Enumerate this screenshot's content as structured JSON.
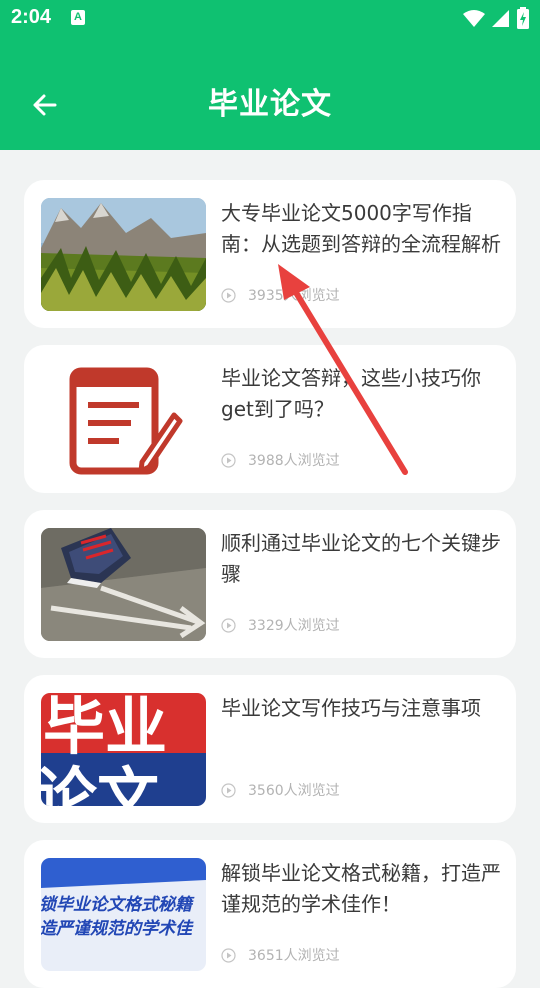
{
  "status_bar": {
    "time": "2:04",
    "notification_badge": "A"
  },
  "header": {
    "title": "毕业论文"
  },
  "articles": [
    {
      "title": "大专毕业论文5000字写作指南：从选题到答辩的全流程解析",
      "views": "3935人浏览过"
    },
    {
      "title": "毕业论文答辩，这些小技巧你get到了吗？",
      "views": "3988人浏览过"
    },
    {
      "title": "顺利通过毕业论文的七个关键步骤",
      "views": "3329人浏览过"
    },
    {
      "title": "毕业论文写作技巧与注意事项",
      "views": "3560人浏览过"
    },
    {
      "title": "解锁毕业论文格式秘籍，打造严谨规范的学术佳作！",
      "views": "3651人浏览过"
    }
  ],
  "thumbnails": {
    "poster_4_text": [
      "毕业",
      "论文"
    ],
    "poster_5_text": [
      "锁毕业论文格式秘籍",
      "造严谨规范的学术佳"
    ]
  },
  "colors": {
    "primary_green": "#0fc171",
    "annotation_red": "#e8413e",
    "icon_red": "#c0392b"
  }
}
